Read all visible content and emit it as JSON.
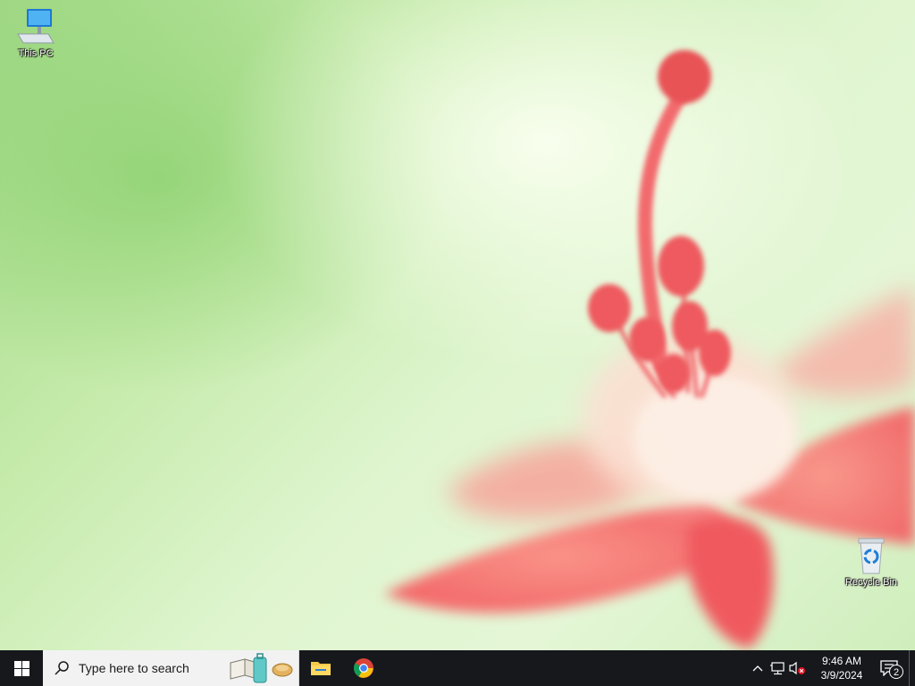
{
  "desktop": {
    "icons": [
      {
        "label": "This PC",
        "icon": "computer-icon"
      },
      {
        "label": "Recycle Bin",
        "icon": "recycle-bin-icon"
      }
    ]
  },
  "taskbar": {
    "start_icon": "windows-logo-icon",
    "search": {
      "placeholder": "Type here to search",
      "icon": "search-icon"
    },
    "apps": [
      {
        "name": "File Explorer",
        "icon": "folder-icon"
      },
      {
        "name": "Google Chrome",
        "icon": "chrome-icon"
      }
    ],
    "tray": {
      "icons": [
        "chevron-up-icon",
        "network-icon",
        "volume-muted-icon"
      ],
      "time": "9:46 AM",
      "date": "3/9/2024",
      "notification_count": "2"
    }
  },
  "colors": {
    "taskbar": "#16181c",
    "search_bg": "#f2f2f2",
    "windows_blue": "#3a9be8",
    "petal": "#f36f6f"
  }
}
